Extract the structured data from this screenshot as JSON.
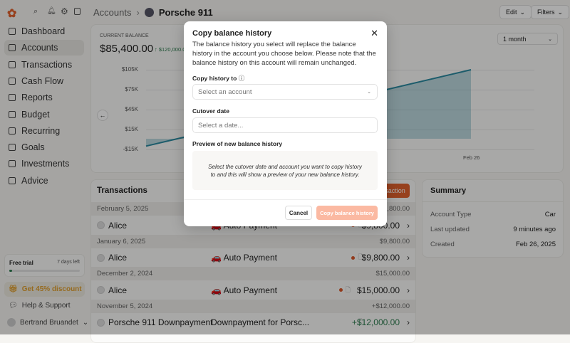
{
  "topbar": {
    "breadcrumb_root": "Accounts",
    "account_name": "Porsche 911",
    "edit": "Edit",
    "filters": "Filters"
  },
  "sidebar": {
    "items": [
      {
        "label": "Dashboard"
      },
      {
        "label": "Accounts"
      },
      {
        "label": "Transactions"
      },
      {
        "label": "Cash Flow"
      },
      {
        "label": "Reports"
      },
      {
        "label": "Budget"
      },
      {
        "label": "Recurring"
      },
      {
        "label": "Goals"
      },
      {
        "label": "Investments"
      },
      {
        "label": "Advice"
      }
    ],
    "trial": {
      "label": "Free trial",
      "days_left": "7 days left",
      "progress": 0.04
    },
    "discount": "Get 45% discount",
    "help": "Help & Support",
    "user": "Bertrand Bruandet"
  },
  "balance": {
    "label": "CURRENT BALANCE",
    "value": "$85,400.00",
    "change": "$120,000.00",
    "period": "1 month"
  },
  "chart_data": {
    "type": "area",
    "ylabels": [
      "$105K",
      "$75K",
      "$45K",
      "$15K",
      "-$15K"
    ],
    "yticks": [
      105000,
      75000,
      45000,
      15000,
      -15000
    ],
    "xlabels": [
      "Feb 26"
    ],
    "ylim": [
      -15000,
      105000
    ],
    "points": [
      {
        "x": "start",
        "y": -10000
      },
      {
        "x": "Feb 26",
        "y": 105000
      }
    ]
  },
  "transactions": {
    "title": "Transactions",
    "add_button": "Add transaction",
    "groups": [
      {
        "date": "February 5, 2025",
        "total": "$9,800.00",
        "rows": [
          {
            "name": "Alice",
            "category": "🚗 Auto Payment",
            "amount": "$9,800.00"
          }
        ]
      },
      {
        "date": "January 6, 2025",
        "total": "$9,800.00",
        "rows": [
          {
            "name": "Alice",
            "category": "🚗 Auto Payment",
            "amount": "$9,800.00"
          }
        ]
      },
      {
        "date": "December 2, 2024",
        "total": "$15,000.00",
        "rows": [
          {
            "name": "Alice",
            "category": "🚗 Auto Payment",
            "amount": "$15,000.00"
          }
        ]
      },
      {
        "date": "November 5, 2024",
        "total": "+$12,000.00",
        "rows": [
          {
            "name": "Porsche 911 Downpayment",
            "category": "Downpayment for Porsc...",
            "amount": "+$12,000.00"
          }
        ]
      }
    ]
  },
  "summary": {
    "title": "Summary",
    "rows": [
      {
        "label": "Account Type",
        "value": "Car"
      },
      {
        "label": "Last updated",
        "value": "9 minutes ago"
      },
      {
        "label": "Created",
        "value": "Feb 26, 2025"
      }
    ]
  },
  "modal": {
    "title": "Copy balance history",
    "description": "The balance history you select will replace the balance history in the account you choose below. Please note that the balance history on this account will remain unchanged.",
    "copy_to_label": "Copy history to",
    "account_placeholder": "Select an account",
    "cutover_label": "Cutover date",
    "date_placeholder": "Select a date...",
    "preview_label": "Preview of new balance history",
    "preview_text": "Select the cutover date and account you want to copy history to and this will show a preview of your new balance history.",
    "cancel": "Cancel",
    "confirm": "Copy balance history"
  },
  "colors": {
    "accent": "#e2622e",
    "positive": "#2e7d4f",
    "chart": "#2a8aa0"
  }
}
